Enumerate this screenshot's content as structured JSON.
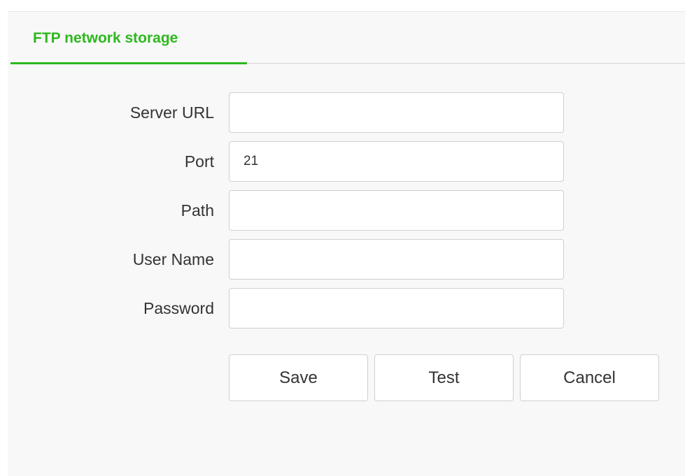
{
  "tab": {
    "label": "FTP network storage"
  },
  "form": {
    "server_url": {
      "label": "Server URL",
      "value": ""
    },
    "port": {
      "label": "Port",
      "value": "21"
    },
    "path": {
      "label": "Path",
      "value": ""
    },
    "user_name": {
      "label": "User Name",
      "value": ""
    },
    "password": {
      "label": "Password",
      "value": ""
    }
  },
  "buttons": {
    "save": "Save",
    "test": "Test",
    "cancel": "Cancel"
  },
  "colors": {
    "accent": "#2eb81f"
  }
}
